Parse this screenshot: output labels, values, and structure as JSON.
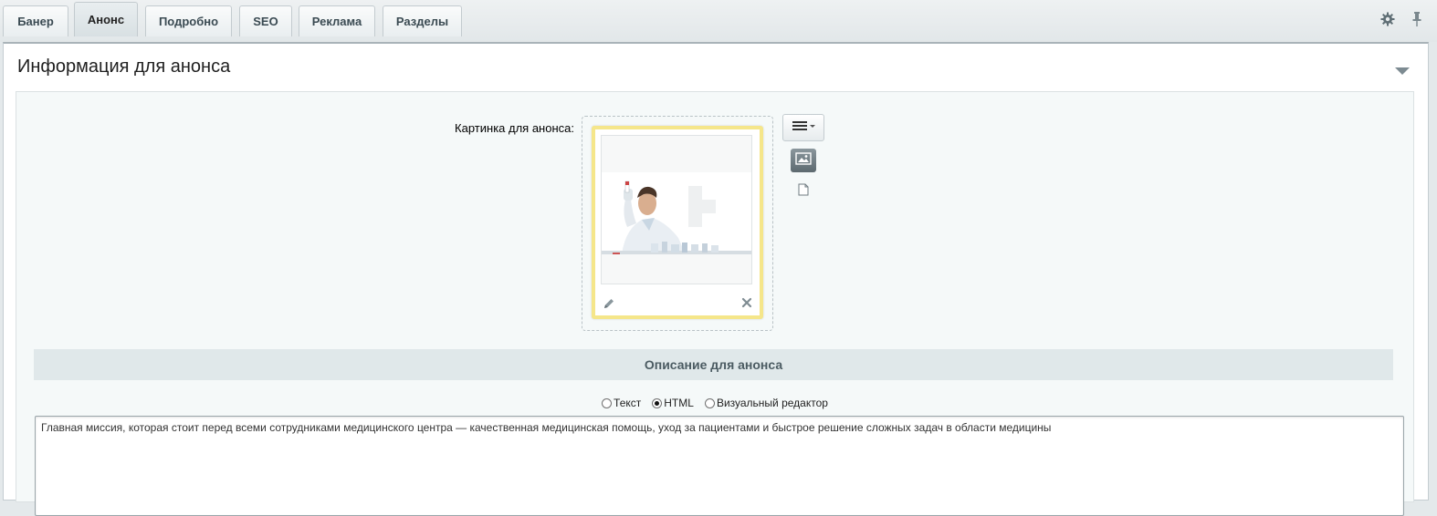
{
  "tabs": [
    {
      "label": "Банер",
      "active": false
    },
    {
      "label": "Анонс",
      "active": true
    },
    {
      "label": "Подробно",
      "active": false
    },
    {
      "label": "SEO",
      "active": false
    },
    {
      "label": "Реклама",
      "active": false
    },
    {
      "label": "Разделы",
      "active": false
    }
  ],
  "toolbar_icons": {
    "settings": "gear-icon",
    "pin": "pin-icon"
  },
  "section": {
    "title": "Информация для анонса"
  },
  "picture": {
    "label": "Картинка для анонса:",
    "accent_color": "#f5e68a"
  },
  "description": {
    "header": "Описание для анонса",
    "formats": [
      {
        "label": "Текст",
        "checked": false
      },
      {
        "label": "HTML",
        "checked": true
      },
      {
        "label": "Визуальный редактор",
        "checked": false
      }
    ],
    "value": "Главная миссия, которая стоит перед всеми сотрудниками медицинского центра — качественная медицинская помощь, уход за пациентами и быстрое решение сложных задач в области медицины"
  }
}
